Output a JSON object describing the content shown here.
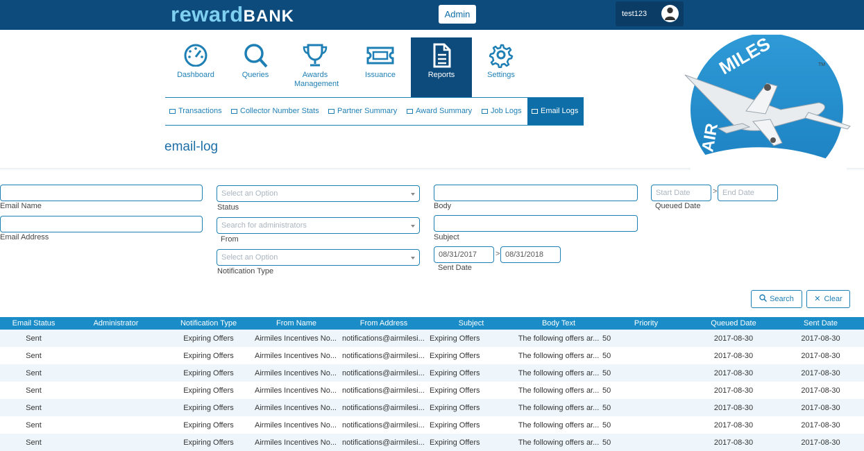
{
  "brand": {
    "reward": "reward",
    "bank": "BANK"
  },
  "header": {
    "admin_label": "Admin",
    "username": "test123"
  },
  "nav": [
    {
      "label": "Dashboard",
      "icon": "dashboard-icon"
    },
    {
      "label": "Queries",
      "icon": "search-icon"
    },
    {
      "label": "Awards Management",
      "icon": "trophy-icon"
    },
    {
      "label": "Issuance",
      "icon": "ticket-icon"
    },
    {
      "label": "Reports",
      "icon": "document-icon",
      "active": true
    },
    {
      "label": "Settings",
      "icon": "gear-icon"
    }
  ],
  "subnav": [
    {
      "label": "Transactions"
    },
    {
      "label": "Collector Number Stats"
    },
    {
      "label": "Partner Summary"
    },
    {
      "label": "Award Summary"
    },
    {
      "label": "Job Logs"
    },
    {
      "label": "Email Logs",
      "active": true
    }
  ],
  "page_title": "email-log",
  "badge": {
    "text_top": "MILES",
    "text_side": "AIR",
    "tm": "TM"
  },
  "filters": {
    "email_name": {
      "label": "Email Name",
      "value": ""
    },
    "email_address": {
      "label": "Email Address",
      "value": ""
    },
    "status": {
      "label": "Status",
      "placeholder": "Select an Option"
    },
    "from": {
      "label": "From",
      "placeholder": "Search for administrators"
    },
    "notification_type": {
      "label": "Notification Type",
      "placeholder": "Select an Option"
    },
    "body": {
      "label": "Body",
      "value": ""
    },
    "subject": {
      "label": "Subject",
      "value": ""
    },
    "sent_date": {
      "label": "Sent Date",
      "start": "08/31/2017",
      "end": "08/31/2018"
    },
    "queued_date": {
      "label": "Queued Date",
      "start_placeholder": "Start Date",
      "end_placeholder": "End Date"
    },
    "range_arrow": ">"
  },
  "actions": {
    "search_label": "Search",
    "clear_label": "Clear"
  },
  "table": {
    "columns": [
      "Email Status",
      "Administrator",
      "Notification Type",
      "From Name",
      "From Address",
      "Subject",
      "Body Text",
      "Priority",
      "Queued Date",
      "Sent Date"
    ],
    "rows": [
      [
        "Sent",
        "",
        "Expiring Offers",
        "Airmiles Incentives No...",
        "notifications@airmilesi...",
        "Expiring Offers",
        "The following offers ar...",
        "50",
        "2017-08-30",
        "2017-08-30"
      ],
      [
        "Sent",
        "",
        "Expiring Offers",
        "Airmiles Incentives No...",
        "notifications@airmilesi...",
        "Expiring Offers",
        "The following offers ar...",
        "50",
        "2017-08-30",
        "2017-08-30"
      ],
      [
        "Sent",
        "",
        "Expiring Offers",
        "Airmiles Incentives No...",
        "notifications@airmilesi...",
        "Expiring Offers",
        "The following offers ar...",
        "50",
        "2017-08-30",
        "2017-08-30"
      ],
      [
        "Sent",
        "",
        "Expiring Offers",
        "Airmiles Incentives No...",
        "notifications@airmilesi...",
        "Expiring Offers",
        "The following offers ar...",
        "50",
        "2017-08-30",
        "2017-08-30"
      ],
      [
        "Sent",
        "",
        "Expiring Offers",
        "Airmiles Incentives No...",
        "notifications@airmilesi...",
        "Expiring Offers",
        "The following offers ar...",
        "50",
        "2017-08-30",
        "2017-08-30"
      ],
      [
        "Sent",
        "",
        "Expiring Offers",
        "Airmiles Incentives No...",
        "notifications@airmilesi...",
        "Expiring Offers",
        "The following offers ar...",
        "50",
        "2017-08-30",
        "2017-08-30"
      ],
      [
        "Sent",
        "",
        "Expiring Offers",
        "Airmiles Incentives No...",
        "notifications@airmilesi...",
        "Expiring Offers",
        "The following offers ar...",
        "50",
        "2017-08-30",
        "2017-08-30"
      ]
    ]
  }
}
